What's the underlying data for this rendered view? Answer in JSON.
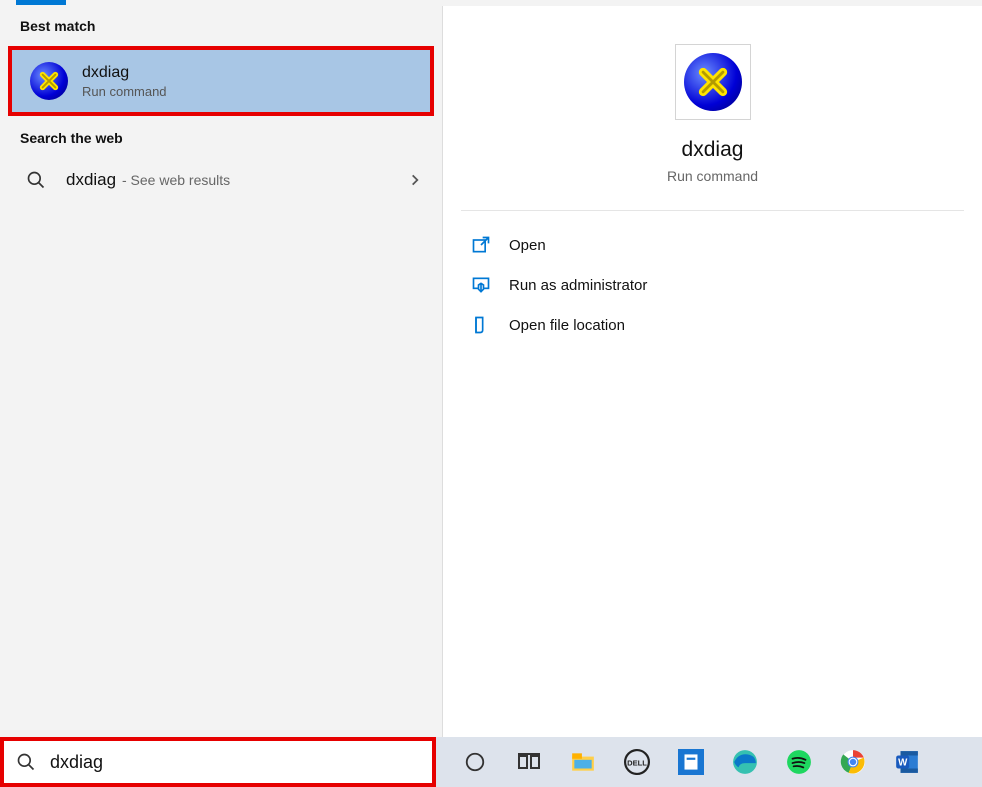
{
  "sections": {
    "best_match": "Best match",
    "web": "Search the web"
  },
  "result": {
    "title": "dxdiag",
    "subtitle": "Run command"
  },
  "web_result": {
    "title": "dxdiag",
    "suffix": " - See web results"
  },
  "preview": {
    "title": "dxdiag",
    "subtitle": "Run command"
  },
  "actions": {
    "open": "Open",
    "admin": "Run as administrator",
    "location": "Open file location"
  },
  "search": {
    "value": "dxdiag"
  }
}
